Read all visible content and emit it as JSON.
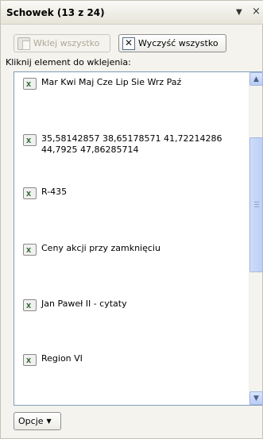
{
  "pane": {
    "title": "Schowek (13 z 24)",
    "menu_glyph": "▼",
    "close_glyph": "×"
  },
  "toolbar": {
    "paste_all_label": "Wklej wszystko",
    "paste_all_icon": "paste-icon",
    "clear_all_label": "Wyczyść wszystko",
    "clear_all_icon": "clear-clipboard-icon"
  },
  "hint": "Kliknij element do wklejenia:",
  "items": [
    {
      "text": "Mar Kwi Maj Cze Lip Sie Wrz Paź",
      "icon": "excel-clip-icon"
    },
    {
      "text": "35,58142857 38,65178571 41,72214286 44,7925 47,86285714",
      "icon": "excel-clip-icon"
    },
    {
      "text": "R-435",
      "icon": "excel-clip-icon"
    },
    {
      "text": "Ceny akcji przy zamknięciu",
      "icon": "excel-clip-icon"
    },
    {
      "text": "Jan Paweł II - cytaty",
      "icon": "excel-clip-icon"
    },
    {
      "text": "Region VI",
      "icon": "excel-clip-icon"
    }
  ],
  "scrollbar": {
    "up": "▲",
    "down": "▼"
  },
  "options": {
    "label": "Opcje",
    "arrow": "▼"
  }
}
